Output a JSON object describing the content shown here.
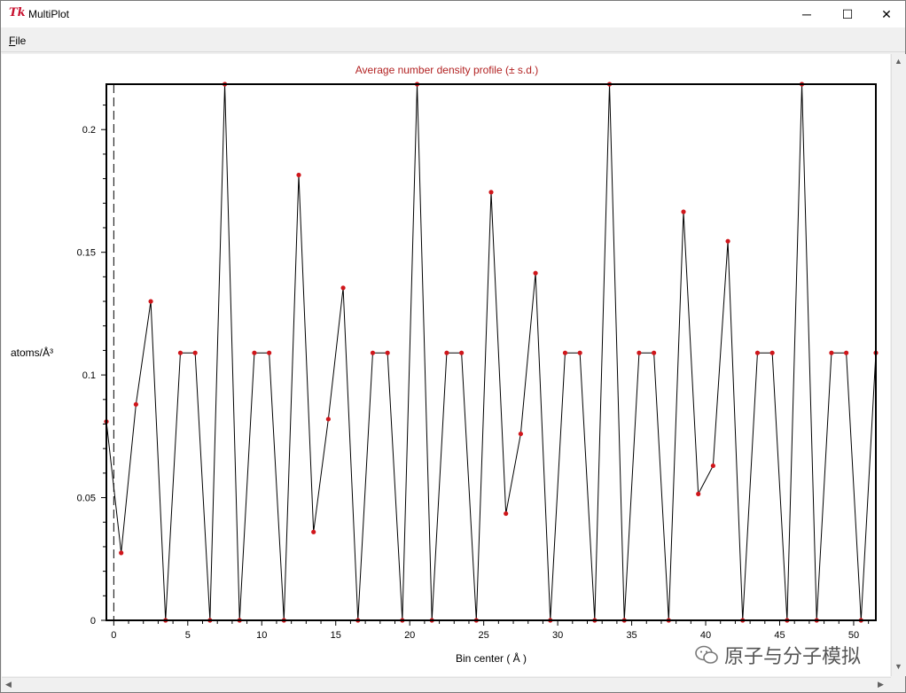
{
  "window": {
    "title": "MultiPlot",
    "app_icon": "tk-feather-icon"
  },
  "window_controls": {
    "minimize": "─",
    "maximize": "☐",
    "close": "✕"
  },
  "menu": {
    "file_label": "File"
  },
  "chart_data": {
    "type": "line",
    "title": "Average number density profile (± s.d.)",
    "xlabel": "Bin center ( Å )",
    "ylabel": "atoms/Å³",
    "xlim": [
      -0.5,
      51.5
    ],
    "ylim": [
      0,
      0.2185
    ],
    "xticks": [
      0,
      5,
      10,
      15,
      20,
      25,
      30,
      35,
      40,
      45,
      50
    ],
    "xtick_labels": [
      "0",
      "5",
      "10",
      "15",
      "20",
      "25",
      "30",
      "35",
      "40",
      "45",
      "50"
    ],
    "yticks": [
      0,
      0.05,
      0.1,
      0.15,
      0.2
    ],
    "ytick_labels": [
      "0",
      "0.05",
      "0.1",
      "0.15",
      "0.2"
    ],
    "reference_line_x": 0,
    "grid": false,
    "line_color": "#000000",
    "marker_color": "#d0161b",
    "title_color": "#b22222",
    "series": [
      {
        "x": [
          -0.5,
          0.5,
          1.5,
          2.5,
          3.5,
          4.5,
          5.5,
          6.5,
          7.5,
          8.5,
          9.5,
          10.5,
          11.5,
          12.5,
          13.5,
          14.5,
          15.5,
          16.5,
          17.5,
          18.5,
          19.5,
          20.5,
          21.5,
          22.5,
          23.5,
          24.5,
          25.5,
          26.5,
          27.5,
          28.5,
          29.5,
          30.5,
          31.5,
          32.5,
          33.5,
          34.5,
          35.5,
          36.5,
          37.5,
          38.5,
          39.5,
          40.5,
          41.5,
          42.5,
          43.5,
          44.5,
          45.5,
          46.5,
          47.5,
          48.5,
          49.5,
          50.5,
          51.5
        ],
        "y": [
          0.081,
          0.0275,
          0.088,
          0.13,
          0,
          0.109,
          0.109,
          0,
          0.2185,
          0,
          0.109,
          0.109,
          0,
          0.1815,
          0.036,
          0.082,
          0.1355,
          0,
          0.109,
          0.109,
          0,
          0.2185,
          0,
          0.109,
          0.109,
          0,
          0.1745,
          0.0435,
          0.076,
          0.1415,
          0,
          0.109,
          0.109,
          0,
          0.2185,
          0,
          0.109,
          0.109,
          0,
          0.1665,
          0.0515,
          0.063,
          0.1545,
          0,
          0.109,
          0.109,
          0,
          0.2185,
          0,
          0.109,
          0.109,
          0,
          0.109
        ]
      }
    ]
  },
  "watermark": {
    "text": "原子与分子模拟",
    "icon": "wechat-icon"
  }
}
